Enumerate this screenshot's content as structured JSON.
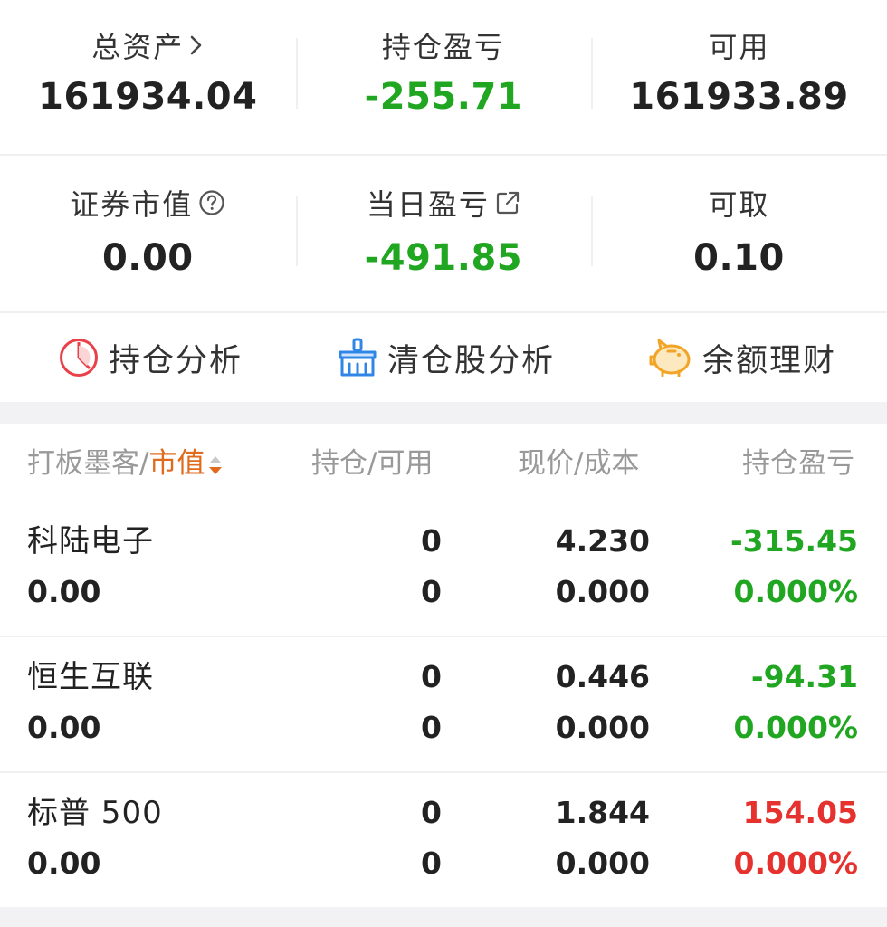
{
  "summary": {
    "total_assets": {
      "label": "总资产",
      "value": "161934.04"
    },
    "position_pl": {
      "label": "持仓盈亏",
      "value": "-255.71"
    },
    "available": {
      "label": "可用",
      "value": "161933.89"
    },
    "securities_value": {
      "label": "证券市值",
      "value": "0.00"
    },
    "daily_pl": {
      "label": "当日盈亏",
      "value": "-491.85"
    },
    "withdrawable": {
      "label": "可取",
      "value": "0.10"
    }
  },
  "tools": {
    "position_analysis": "持仓分析",
    "cleared_analysis": "清仓股分析",
    "balance_finance": "余额理财"
  },
  "table": {
    "headers": {
      "name_prefix": "打板墨客",
      "slash": "/",
      "market_value": "市值",
      "holding": "持仓/可用",
      "price": "现价/成本",
      "pl": "持仓盈亏"
    },
    "rows": [
      {
        "name": "科陆电子",
        "market_value": "0.00",
        "holding": "0",
        "available": "0",
        "price": "4.230",
        "cost": "0.000",
        "pl": "-315.45",
        "pl_pct": "0.000%"
      },
      {
        "name": "恒生互联",
        "market_value": "0.00",
        "holding": "0",
        "available": "0",
        "price": "0.446",
        "cost": "0.000",
        "pl": "-94.31",
        "pl_pct": "0.000%"
      },
      {
        "name": "标普 500",
        "market_value": "0.00",
        "holding": "0",
        "available": "0",
        "price": "1.844",
        "cost": "0.000",
        "pl": "154.05",
        "pl_pct": "0.000%"
      }
    ]
  },
  "colors": {
    "gain": "#e6322e",
    "loss": "#20a620",
    "accent": "#e06a1d"
  }
}
